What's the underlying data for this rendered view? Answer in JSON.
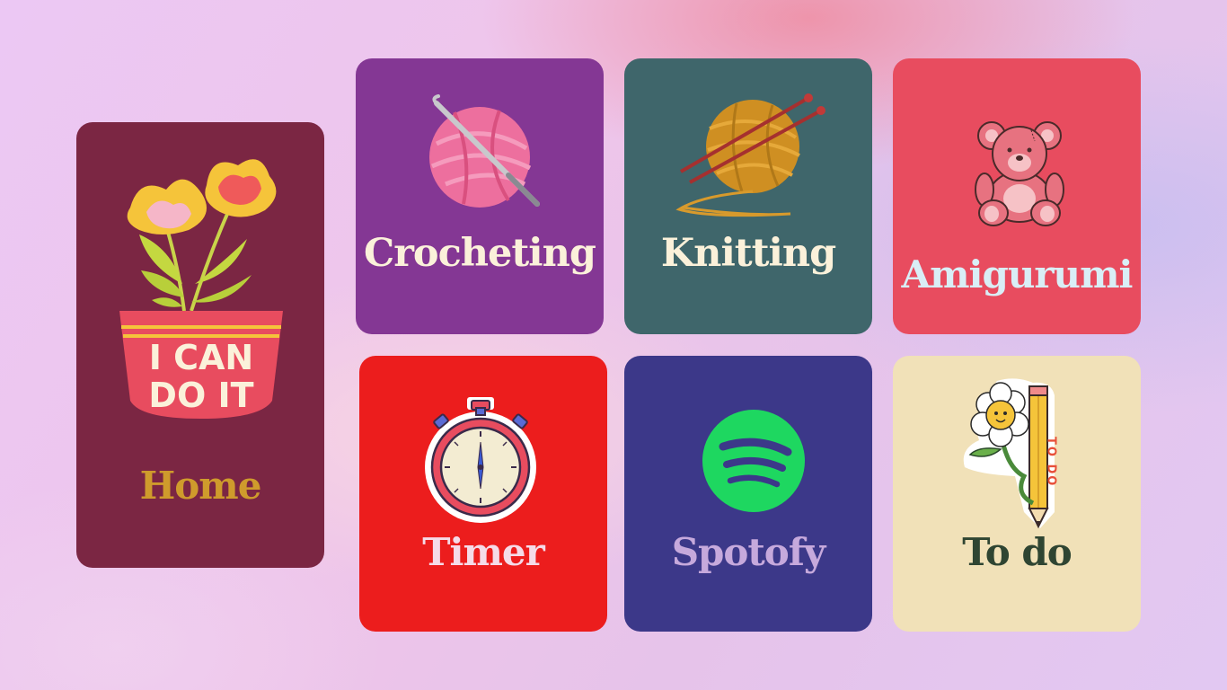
{
  "tiles": {
    "home": {
      "label": "Home",
      "icon": "flower-pot-icon",
      "pot_text_line1": "I CAN",
      "pot_text_line2": "DO IT",
      "color": "#7b2643"
    },
    "crocheting": {
      "label": "Crocheting",
      "icon": "yarn-ball-crochet-hook-icon",
      "color": "#843794"
    },
    "knitting": {
      "label": "Knitting",
      "icon": "yarn-ball-knitting-needles-icon",
      "color": "#3f666b"
    },
    "amigurumi": {
      "label": "Amigurumi",
      "icon": "teddy-bear-icon",
      "color": "#e84c5f"
    },
    "timer": {
      "label": "Timer",
      "icon": "stopwatch-icon",
      "color": "#ec1d1d"
    },
    "spotify": {
      "label": "Spotofy",
      "icon": "spotify-logo-icon",
      "color": "#3c3889"
    },
    "todo": {
      "label": "To do",
      "icon": "pencil-flower-todo-icon",
      "sticker_text": "TO DO",
      "color": "#f1e1b8"
    }
  }
}
